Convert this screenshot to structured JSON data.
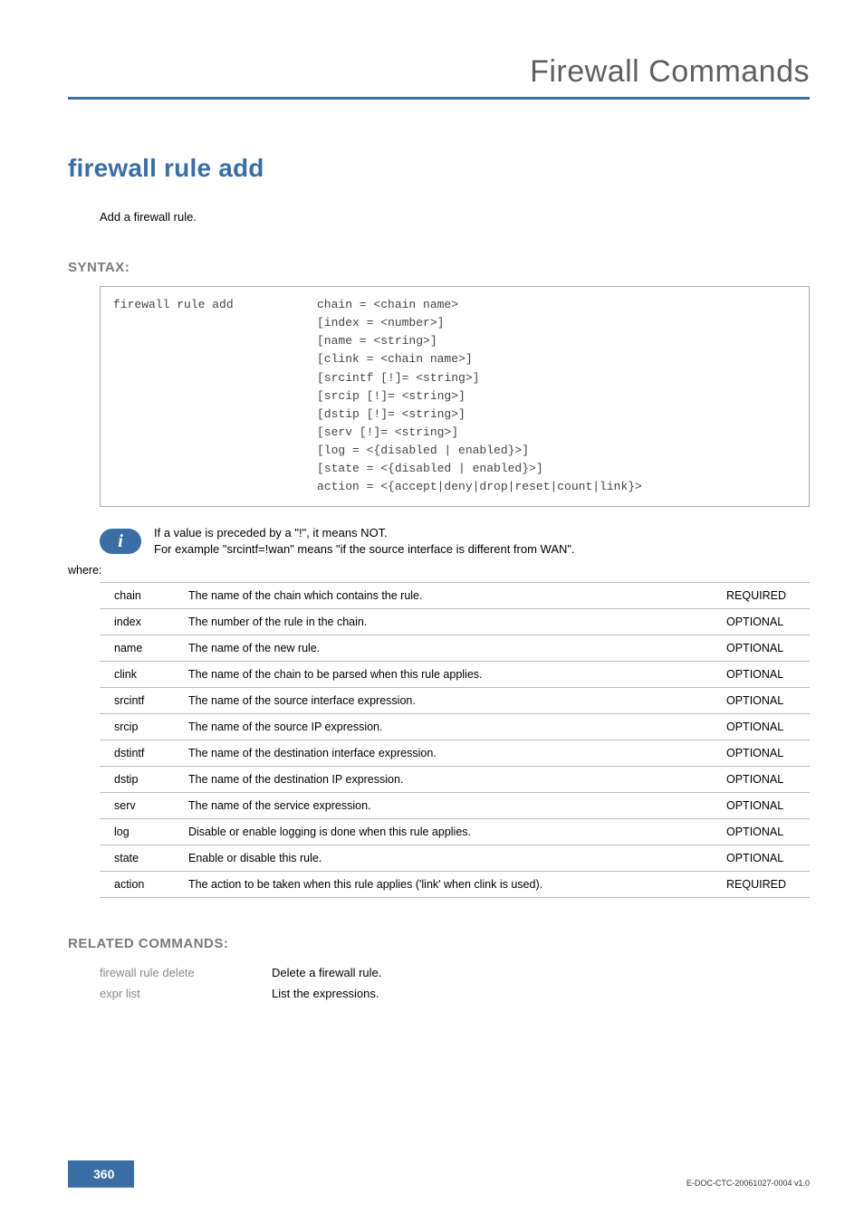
{
  "header": {
    "title": "Firewall Commands"
  },
  "command": {
    "title": "firewall rule add",
    "description": "Add a firewall rule."
  },
  "syntax": {
    "heading": "SYNTAX:",
    "cmd": "firewall rule add",
    "args": "chain = <chain name>\n[index = <number>]\n[name = <string>]\n[clink = <chain name>]\n[srcintf [!]= <string>]\n[srcip [!]= <string>]\n[dstip [!]= <string>]\n[serv [!]= <string>]\n[log = <{disabled | enabled}>]\n[state = <{disabled | enabled}>]\naction = <{accept|deny|drop|reset|count|link}>"
  },
  "info": {
    "line1": "If a value is preceded by a \"!\", it means NOT.",
    "line2": "For example \"srcintf=!wan\" means \"if the source interface is different from WAN\"."
  },
  "where_label": "where:",
  "params": [
    {
      "name": "chain",
      "desc": "The name of the chain which contains the rule.",
      "req": "REQUIRED"
    },
    {
      "name": "index",
      "desc": "The number of the rule in the chain.",
      "req": "OPTIONAL"
    },
    {
      "name": "name",
      "desc": "The name of the new rule.",
      "req": "OPTIONAL"
    },
    {
      "name": "clink",
      "desc": "The name of the chain to be parsed when this rule applies.",
      "req": "OPTIONAL"
    },
    {
      "name": "srcintf",
      "desc": "The name of the source interface expression.",
      "req": "OPTIONAL"
    },
    {
      "name": "srcip",
      "desc": "The name of the source IP expression.",
      "req": "OPTIONAL"
    },
    {
      "name": "dstintf",
      "desc": "The name of the destination interface expression.",
      "req": "OPTIONAL"
    },
    {
      "name": "dstip",
      "desc": "The name of the destination IP expression.",
      "req": "OPTIONAL"
    },
    {
      "name": "serv",
      "desc": "The name of the service expression.",
      "req": "OPTIONAL"
    },
    {
      "name": "log",
      "desc": "Disable or enable logging is done when this rule applies.",
      "req": "OPTIONAL"
    },
    {
      "name": "state",
      "desc": "Enable or disable this rule.",
      "req": "OPTIONAL"
    },
    {
      "name": "action",
      "desc": "The action to be taken when this rule applies ('link' when clink is used).",
      "req": "REQUIRED"
    }
  ],
  "related": {
    "heading": "RELATED COMMANDS:",
    "items": [
      {
        "cmd": "firewall rule delete",
        "desc": "Delete a firewall rule."
      },
      {
        "cmd": "expr list",
        "desc": "List the expressions."
      }
    ]
  },
  "footer": {
    "page": "360",
    "docid": "E-DOC-CTC-20061027-0004 v1.0"
  }
}
